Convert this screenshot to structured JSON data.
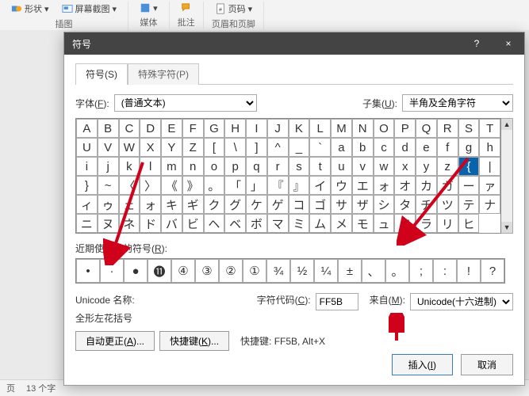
{
  "ribbon": {
    "shape": "形状",
    "screenshot": "屏幕截图",
    "insertGroup": "插图",
    "mediaGroup": "媒体",
    "annotateGroup": "批注",
    "headerFooterGroup": "页眉和页脚",
    "pageNumber": "页码"
  },
  "status": {
    "page": "页",
    "words": "13 个字"
  },
  "dialog": {
    "title": "符号",
    "tabs": {
      "symbols": "符号(S)",
      "special": "特殊字符(P)"
    },
    "fontLabelPre": "字体(",
    "fontLabelKey": "F",
    "fontLabelPost": "):",
    "fontValue": "(普通文本)",
    "subsetLabelPre": "子集(",
    "subsetLabelKey": "U",
    "subsetLabelPost": "):",
    "subsetValue": "半角及全角字符",
    "grid": [
      "A",
      "B",
      "C",
      "D",
      "E",
      "F",
      "G",
      "H",
      "I",
      "J",
      "K",
      "L",
      "M",
      "N",
      "O",
      "P",
      "Q",
      "R",
      "S",
      "T",
      "U",
      "V",
      "W",
      "X",
      "Y",
      "Z",
      "[",
      "\\",
      "]",
      "^",
      "_",
      "`",
      "a",
      "b",
      "c",
      "d",
      "e",
      "f",
      "g",
      "h",
      "i",
      "j",
      "k",
      "l",
      "m",
      "n",
      "o",
      "p",
      "q",
      "r",
      "s",
      "t",
      "u",
      "v",
      "w",
      "x",
      "y",
      "z",
      "{",
      "|",
      "}",
      "~",
      "〈",
      "〉",
      "《",
      "》",
      "。",
      "「",
      "」",
      "『",
      "』",
      "イ",
      "ウ",
      "エ",
      "ォ",
      "オ",
      "カ",
      "ガ",
      "ー",
      "ァ",
      "ィ",
      "ゥ",
      "ェ",
      "ォ",
      "キ",
      "ギ",
      "ク",
      "グ",
      "ケ",
      "ゲ",
      "コ",
      "ゴ",
      "サ",
      "ザ",
      "シ",
      "タ",
      "チ",
      "ツ",
      "テ",
      "ナ",
      "ニ",
      "ヌ",
      "ネ",
      "ド",
      "バ",
      "ビ",
      "ヘ",
      "ベ",
      "ボ",
      "マ",
      "ミ",
      "ム",
      "メ",
      "モ",
      "ュ",
      "ヨ",
      "ラ",
      "リ",
      "ヒ"
    ],
    "selectedIndex": 58,
    "recentLabelPre": "近期使用过的符号(",
    "recentLabelKey": "R",
    "recentLabelPost": "):",
    "recent": [
      "•",
      "·",
      "●",
      "⓫",
      "④",
      "③",
      "②",
      "①",
      "¾",
      "½",
      "¼",
      "±",
      "、",
      "。",
      ";",
      ":",
      "!",
      "?"
    ],
    "unicodeNameLabel": "Unicode 名称:",
    "unicodeName": "全形左花括号",
    "charCodeLabelPre": "字符代码(",
    "charCodeLabelKey": "C",
    "charCodeLabelPost": "):",
    "charCode": "FF5B",
    "fromLabelPre": "来自(",
    "fromLabelKey": "M",
    "fromLabelPost": "):",
    "fromValue": "Unicode(十六进制)",
    "autoCorrectPre": "自动更正(",
    "autoCorrectKey": "A",
    "autoCorrectPost": ")...",
    "shortcutKeyBtnPre": "快捷键(",
    "shortcutKeyBtnKey": "K",
    "shortcutKeyBtnPost": ")...",
    "shortcutLabel": "快捷键: FF5B, Alt+X",
    "insertPre": "插入(",
    "insertKey": "I",
    "insertPost": ")",
    "cancel": "取消",
    "help": "?",
    "close": "×"
  }
}
